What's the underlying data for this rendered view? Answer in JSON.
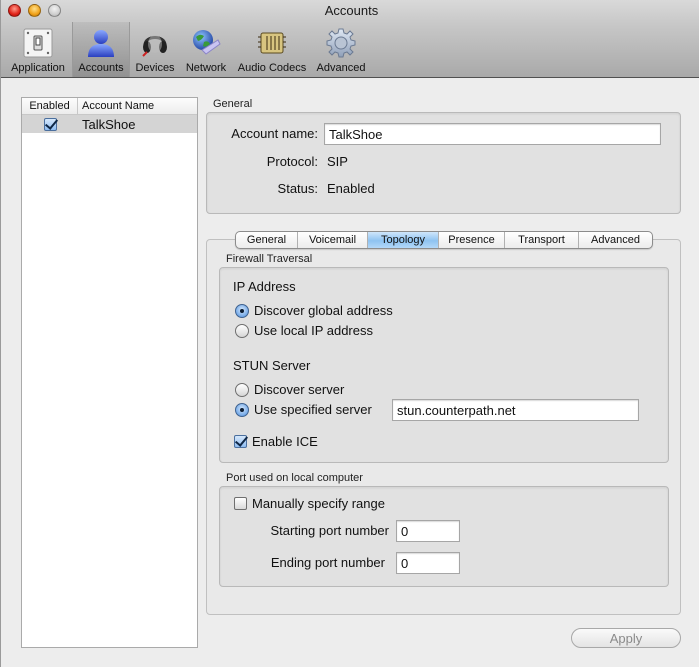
{
  "window": {
    "title": "Accounts"
  },
  "toolbar": {
    "items": [
      {
        "label": "Application",
        "icon": "switch-icon",
        "selected": false
      },
      {
        "label": "Accounts",
        "icon": "user-icon",
        "selected": true
      },
      {
        "label": "Devices",
        "icon": "headset-icon",
        "selected": false
      },
      {
        "label": "Network",
        "icon": "globe-network-icon",
        "selected": false
      },
      {
        "label": "Audio Codecs",
        "icon": "chip-icon",
        "selected": false
      },
      {
        "label": "Advanced",
        "icon": "gear-icon",
        "selected": false
      }
    ]
  },
  "accounts_table": {
    "columns": [
      "Enabled",
      "Account Name"
    ],
    "rows": [
      {
        "enabled": true,
        "name": "TalkShoe"
      }
    ]
  },
  "general": {
    "section_label": "General",
    "account_name_label": "Account name:",
    "account_name_value": "TalkShoe",
    "protocol_label": "Protocol:",
    "protocol_value": "SIP",
    "status_label": "Status:",
    "status_value": "Enabled"
  },
  "tabs": {
    "items": [
      "General",
      "Voicemail",
      "Topology",
      "Presence",
      "Transport",
      "Advanced"
    ],
    "active": "Topology"
  },
  "firewall": {
    "section_label": "Firewall Traversal",
    "ip_address_heading": "IP Address",
    "ip_options": [
      {
        "label": "Discover global address",
        "selected": true
      },
      {
        "label": "Use local IP address",
        "selected": false
      }
    ],
    "stun_heading": "STUN Server",
    "stun_options": [
      {
        "label": "Discover server",
        "selected": false
      },
      {
        "label": "Use specified server",
        "selected": true
      }
    ],
    "stun_server_value": "stun.counterpath.net",
    "enable_ice_label": "Enable ICE",
    "enable_ice_checked": true
  },
  "ports": {
    "section_label": "Port used on local computer",
    "manual_range_label": "Manually specify range",
    "manual_range_checked": false,
    "start_label": "Starting port number",
    "start_value": "0",
    "end_label": "Ending port number",
    "end_value": "0"
  },
  "buttons": {
    "apply": "Apply"
  }
}
